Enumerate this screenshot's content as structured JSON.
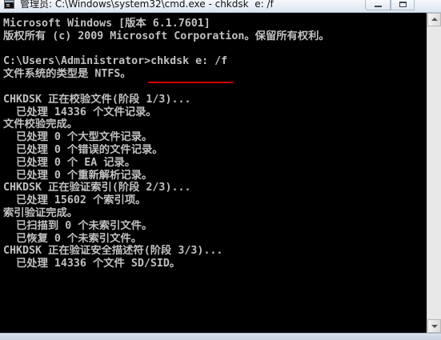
{
  "window": {
    "title": "管理员: C:\\Windows\\system32\\cmd.exe - chkdsk  e: /f",
    "icon": "cmd-icon"
  },
  "controls": {
    "minimize_icon": "minimize-icon",
    "maximize_icon": "maximize-icon"
  },
  "console": {
    "lines": [
      "Microsoft Windows [版本 6.1.7601]",
      "版权所有 (c) 2009 Microsoft Corporation。保留所有权利。",
      "",
      "C:\\Users\\Administrator>chkdsk e: /f",
      "文件系统的类型是 NTFS。",
      "",
      "CHKDSK 正在校验文件(阶段 1/3)...",
      "  已处理 14336 个文件记录。",
      "文件校验完成。",
      "  已处理 0 个大型文件记录。",
      "  已处理 0 个错误的文件记录。",
      "  已处理 0 个 EA 记录。",
      "  已处理 0 个重新解析记录。",
      "CHKDSK 正在验证索引(阶段 2/3)...",
      "  已处理 15602 个索引项。",
      "索引验证完成。",
      "  已扫描到 0 个未索引文件。",
      "  已恢复 0 个未索引文件。",
      "CHKDSK 正在验证安全描述符(阶段 3/3)...",
      "  已处理 14336 个文件 SD/SID。"
    ]
  },
  "scrollbar": {
    "up_icon": "scroll-up-arrow-icon",
    "down_icon": "scroll-down-arrow-icon"
  },
  "colors": {
    "console_bg": "#000000",
    "console_text": "#c0c0c0",
    "annotation": "#d40000"
  }
}
